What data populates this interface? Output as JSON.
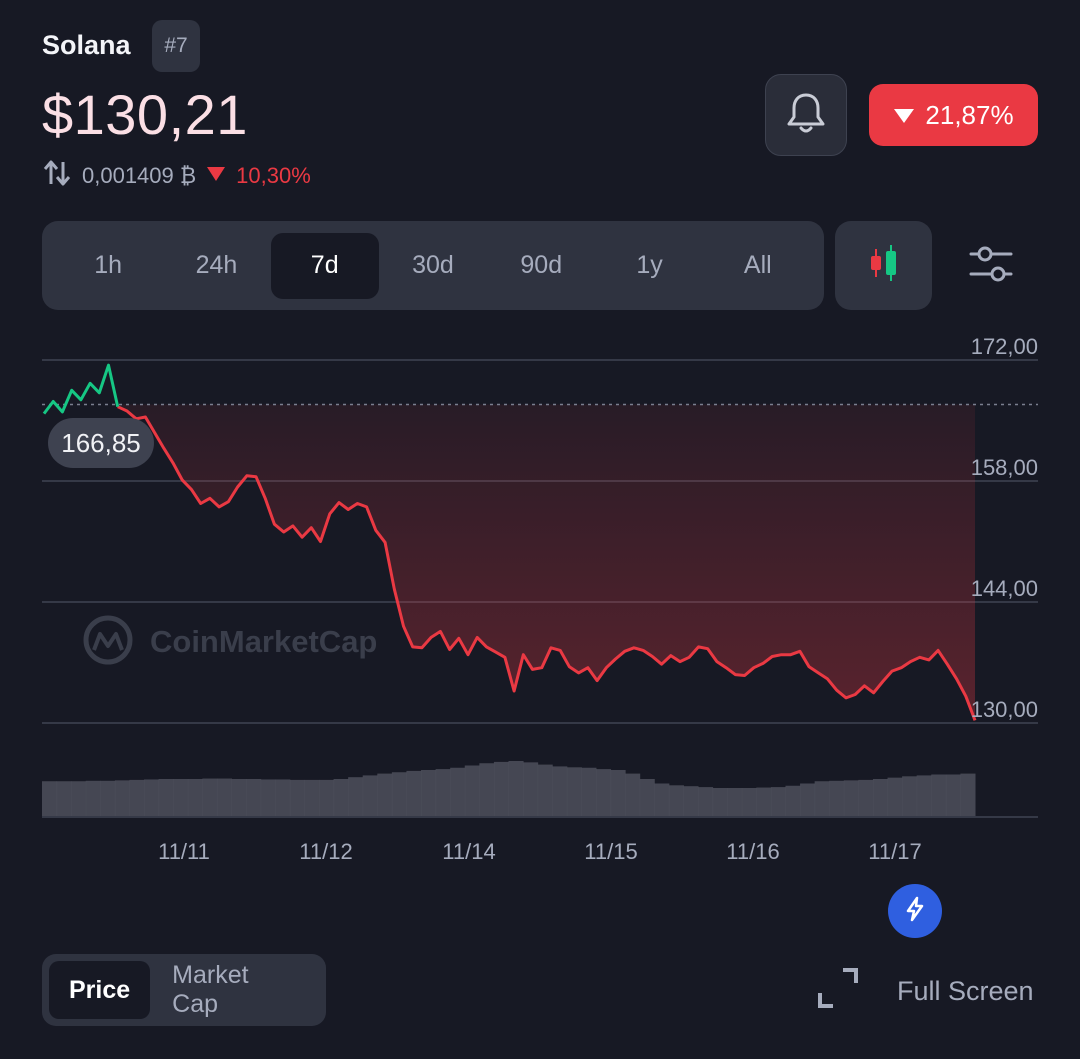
{
  "coin": {
    "name": "Solana",
    "rank": "#7"
  },
  "price": {
    "value": "$130,21",
    "btc_value": "0,001409 ₿",
    "btc_change": "10,30%"
  },
  "change_badge": {
    "value": "21,87%",
    "direction": "down"
  },
  "range_tabs": [
    "1h",
    "24h",
    "7d",
    "30d",
    "90d",
    "1y",
    "All"
  ],
  "active_range": "7d",
  "chart_toggle": {
    "price": "Price",
    "market_cap": "Market Cap",
    "active": "Price"
  },
  "fullscreen": {
    "label": "Full Screen"
  },
  "watermark": "CoinMarketCap",
  "icons": {
    "bell": "bell-icon",
    "swap": "swap-arrows-icon",
    "candle": "candlestick-icon",
    "settings": "sliders-icon",
    "fullscreen": "expand-icon",
    "fab": "lightning-icon",
    "logo": "coinmarketcap-logo-icon"
  },
  "colors": {
    "up": "#16c784",
    "down": "#ea3943",
    "background": "#171924",
    "accent": "#2f5fe0"
  },
  "chart_data": {
    "type": "line",
    "title": "",
    "xlabel": "",
    "ylabel": "",
    "x_ticks": [
      "11/11",
      "11/12",
      "11/14",
      "11/15",
      "11/16",
      "11/17"
    ],
    "y_ticks": [
      "172,00",
      "158,00",
      "144,00",
      "130,00"
    ],
    "y_tick_values": [
      172,
      158,
      144,
      130
    ],
    "ylim": [
      126,
      178
    ],
    "open_price": 166.85,
    "open_label": "166,85",
    "series": [
      {
        "values": [
          165.8,
          167.2,
          166.0,
          168.5,
          167.4,
          169.3,
          168.2,
          171.4,
          166.6,
          166.1,
          165.2,
          165.4,
          163.6,
          161.8,
          160.1,
          158.1,
          157.0,
          155.4,
          156.0,
          155.0,
          155.6,
          157.3,
          158.6,
          158.5,
          156.0,
          153.0,
          152.1,
          152.8,
          151.5,
          152.6,
          151.0,
          154.2,
          155.5,
          154.7,
          155.4,
          155.0,
          152.3,
          150.9,
          145.5,
          141.2,
          138.8,
          138.7,
          139.9,
          140.6,
          138.5,
          139.8,
          137.9,
          139.9,
          138.8,
          138.2,
          137.6,
          133.7,
          137.9,
          136.2,
          136.4,
          138.7,
          138.4,
          136.5,
          135.8,
          136.4,
          134.9,
          136.4,
          137.4,
          138.3,
          138.7,
          138.4,
          137.7,
          136.8,
          137.8,
          137.1,
          137.6,
          138.8,
          138.6,
          137.1,
          136.4,
          135.6,
          135.5,
          136.4,
          136.9,
          137.7,
          137.9,
          137.9,
          138.3,
          136.5,
          135.8,
          135.1,
          133.8,
          132.9,
          133.3,
          134.3,
          133.5,
          134.8,
          136.0,
          136.4,
          137.1,
          137.6,
          137.3,
          138.4,
          136.8,
          135.1,
          133.1,
          130.3
        ]
      }
    ],
    "volume_bars": "relative",
    "volume": [
      0.55,
      0.55,
      0.55,
      0.56,
      0.56,
      0.57,
      0.58,
      0.59,
      0.6,
      0.6,
      0.6,
      0.61,
      0.61,
      0.6,
      0.6,
      0.59,
      0.59,
      0.58,
      0.58,
      0.58,
      0.6,
      0.64,
      0.68,
      0.72,
      0.75,
      0.78,
      0.8,
      0.82,
      0.85,
      0.9,
      0.95,
      0.98,
      1.0,
      0.97,
      0.92,
      0.88,
      0.86,
      0.85,
      0.82,
      0.8,
      0.72,
      0.6,
      0.5,
      0.46,
      0.44,
      0.42,
      0.4,
      0.4,
      0.4,
      0.41,
      0.42,
      0.45,
      0.5,
      0.55,
      0.56,
      0.57,
      0.58,
      0.6,
      0.63,
      0.66,
      0.68,
      0.7,
      0.7,
      0.72
    ]
  }
}
